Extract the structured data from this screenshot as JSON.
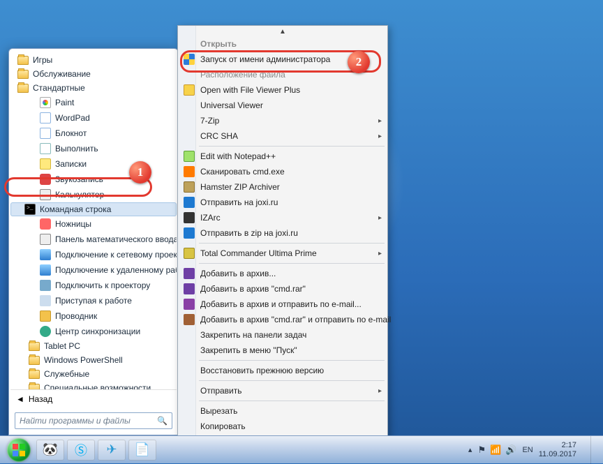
{
  "startmenu": {
    "folders_top": [
      "Игры",
      "Обслуживание",
      "Стандартные"
    ],
    "items": [
      {
        "icon": "c-paint",
        "label": "Paint"
      },
      {
        "icon": "c-doc",
        "label": "WordPad"
      },
      {
        "icon": "c-doc",
        "label": "Блокнот"
      },
      {
        "icon": "c-run",
        "label": "Выполнить"
      },
      {
        "icon": "c-note",
        "label": "Записки"
      },
      {
        "icon": "c-mic",
        "label": "Звукозапись"
      },
      {
        "icon": "c-calc",
        "label": "Калькулятор"
      },
      {
        "icon": "c-cmd",
        "label": "Командная строка"
      },
      {
        "icon": "c-snip",
        "label": "Ножницы"
      },
      {
        "icon": "c-calc",
        "label": "Панель математического ввода"
      },
      {
        "icon": "c-blue",
        "label": "Подключение к сетевому проектору"
      },
      {
        "icon": "c-blue",
        "label": "Подключение к удаленному рабочему столу"
      },
      {
        "icon": "c-proj",
        "label": "Подключить к проектору"
      },
      {
        "icon": "c-gs",
        "label": "Приступая к работе"
      },
      {
        "icon": "c-exp",
        "label": "Проводник"
      },
      {
        "icon": "c-sync",
        "label": "Центр синхронизации"
      }
    ],
    "folders_bottom": [
      "Tablet PC",
      "Windows PowerShell",
      "Служебные",
      "Специальные возможности"
    ],
    "back_label": "Назад",
    "search_placeholder": "Найти программы и файлы"
  },
  "context_menu": {
    "items": [
      {
        "label": "Открыть",
        "bold": true,
        "truncated": true
      },
      {
        "label": "Запуск от имени администратора",
        "icon": "ci-shield"
      },
      {
        "label": "Расположение файла",
        "truncated": true
      },
      {
        "label": "Open with File Viewer Plus",
        "icon": "ci-fv"
      },
      {
        "label": "Universal Viewer"
      },
      {
        "label": "7-Zip",
        "sub": true
      },
      {
        "label": "CRC SHA",
        "sub": true
      },
      {
        "sep": true
      },
      {
        "label": "Edit with Notepad++",
        "icon": "ci-npp"
      },
      {
        "label": "Сканировать cmd.exe",
        "icon": "ci-av"
      },
      {
        "label": "Hamster ZIP Archiver",
        "icon": "ci-zip"
      },
      {
        "label": "Отправить на joxi.ru",
        "icon": "ci-joxi"
      },
      {
        "label": "IZArc",
        "icon": "ci-izarc",
        "sub": true
      },
      {
        "label": "Отправить в zip на joxi.ru",
        "icon": "ci-joxi"
      },
      {
        "sep": true
      },
      {
        "label": "Total Commander Ultima Prime",
        "icon": "ci-tc",
        "sub": true
      },
      {
        "sep": true
      },
      {
        "label": "Добавить в архив...",
        "icon": "ci-rar"
      },
      {
        "label": "Добавить в архив \"cmd.rar\"",
        "icon": "ci-rar"
      },
      {
        "label": "Добавить в архив и отправить по e-mail...",
        "icon": "ci-rar2"
      },
      {
        "label": "Добавить в архив \"cmd.rar\" и отправить по e-mail",
        "icon": "ci-rar3"
      },
      {
        "label": "Закрепить на панели задач"
      },
      {
        "label": "Закрепить в меню \"Пуск\""
      },
      {
        "sep": true
      },
      {
        "label": "Восстановить прежнюю версию"
      },
      {
        "sep": true
      },
      {
        "label": "Отправить",
        "sub": true
      },
      {
        "sep": true
      },
      {
        "label": "Вырезать"
      },
      {
        "label": "Копировать"
      }
    ]
  },
  "callouts": {
    "b1": "1",
    "b2": "2"
  },
  "tray": {
    "lang": "EN",
    "time": "2:17",
    "date": "11.09.2017"
  }
}
